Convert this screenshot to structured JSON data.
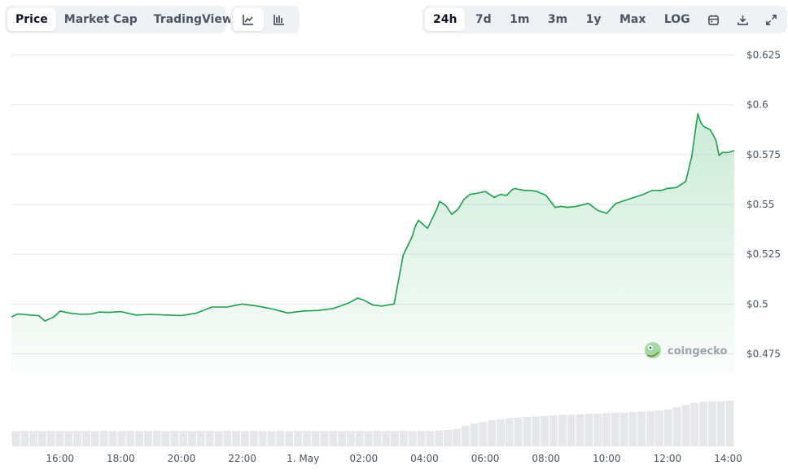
{
  "toolbar": {
    "chart_types": [
      {
        "label": "Price",
        "active": true
      },
      {
        "label": "Market Cap",
        "active": false
      },
      {
        "label": "TradingView",
        "active": false
      }
    ],
    "styles": [
      {
        "icon": "line-chart-icon",
        "active": true
      },
      {
        "icon": "candlestick-chart-icon",
        "active": false
      }
    ],
    "ranges": [
      {
        "label": "24h",
        "active": true
      },
      {
        "label": "7d",
        "active": false
      },
      {
        "label": "1m",
        "active": false
      },
      {
        "label": "3m",
        "active": false
      },
      {
        "label": "1y",
        "active": false
      },
      {
        "label": "Max",
        "active": false
      },
      {
        "label": "LOG",
        "active": false
      }
    ],
    "actions": [
      "calendar-icon",
      "download-icon",
      "expand-icon"
    ]
  },
  "watermark": {
    "text": "coingecko",
    "icon": "coingecko-logo-icon"
  },
  "colors": {
    "line": "#16a34a",
    "fill_top": "#16a34a",
    "grid": "#e5e7eb",
    "volume": "#e5e7eb"
  },
  "chart_data": {
    "type": "area",
    "x_unit": "hours",
    "x_ticks": [
      {
        "label": "16:00",
        "value": 16
      },
      {
        "label": "18:00",
        "value": 18
      },
      {
        "label": "20:00",
        "value": 20
      },
      {
        "label": "22:00",
        "value": 22
      },
      {
        "label": "1. May",
        "value": 24
      },
      {
        "label": "02:00",
        "value": 26
      },
      {
        "label": "04:00",
        "value": 28
      },
      {
        "label": "06:00",
        "value": 30
      },
      {
        "label": "08:00",
        "value": 32
      },
      {
        "label": "10:00",
        "value": 34
      },
      {
        "label": "12:00",
        "value": 36
      },
      {
        "label": "14:00",
        "value": 38
      }
    ],
    "y_ticks": [
      {
        "label": "$0.475",
        "value": 0.475
      },
      {
        "label": "$0.5",
        "value": 0.5
      },
      {
        "label": "$0.525",
        "value": 0.525
      },
      {
        "label": "$0.55",
        "value": 0.55
      },
      {
        "label": "$0.575",
        "value": 0.575
      },
      {
        "label": "$0.6",
        "value": 0.6
      },
      {
        "label": "$0.625",
        "value": 0.625
      }
    ],
    "xlim": [
      14.4,
      38.2
    ],
    "ylim": [
      0.4654,
      0.6362
    ],
    "grid": true,
    "price": {
      "x": [
        14.4,
        14.6,
        14.8,
        15.0,
        15.3,
        15.5,
        15.8,
        16.0,
        16.3,
        16.7,
        17.0,
        17.3,
        17.6,
        18.0,
        18.5,
        19.0,
        19.5,
        20.0,
        20.5,
        21.0,
        21.5,
        22.0,
        22.5,
        23.0,
        23.5,
        24.0,
        24.5,
        25.0,
        25.5,
        25.8,
        26.0,
        26.3,
        26.6,
        26.8,
        27.0,
        27.3,
        27.6,
        27.7,
        27.8,
        28.1,
        28.4,
        28.5,
        28.7,
        28.9,
        29.1,
        29.3,
        29.5,
        29.7,
        30.0,
        30.3,
        30.5,
        30.7,
        30.9,
        31.0,
        31.1,
        31.3,
        31.5,
        31.7,
        32.0,
        32.3,
        32.5,
        32.7,
        33.0,
        33.4,
        33.7,
        34.0,
        34.3,
        34.6,
        34.9,
        35.2,
        35.5,
        35.8,
        36.0,
        36.3,
        36.6,
        36.8,
        36.9,
        37.0,
        37.1,
        37.2,
        37.4,
        37.5,
        37.6,
        37.7,
        37.8,
        38.0,
        38.2
      ],
      "y": [
        0.4935,
        0.495,
        0.4948,
        0.4945,
        0.4942,
        0.4915,
        0.4935,
        0.4965,
        0.4955,
        0.4948,
        0.495,
        0.496,
        0.4958,
        0.4962,
        0.4945,
        0.4948,
        0.4945,
        0.4942,
        0.4955,
        0.4985,
        0.4985,
        0.5,
        0.499,
        0.4975,
        0.4955,
        0.4965,
        0.4968,
        0.4978,
        0.5005,
        0.503,
        0.502,
        0.4995,
        0.499,
        0.4995,
        0.5,
        0.5245,
        0.534,
        0.539,
        0.542,
        0.538,
        0.5475,
        0.5515,
        0.5495,
        0.545,
        0.5475,
        0.5525,
        0.555,
        0.5555,
        0.5565,
        0.5535,
        0.555,
        0.5545,
        0.5575,
        0.558,
        0.5575,
        0.557,
        0.557,
        0.5565,
        0.5545,
        0.5485,
        0.549,
        0.5485,
        0.549,
        0.5505,
        0.547,
        0.5455,
        0.5505,
        0.552,
        0.5535,
        0.555,
        0.557,
        0.557,
        0.558,
        0.5585,
        0.5615,
        0.574,
        0.585,
        0.5955,
        0.591,
        0.589,
        0.5875,
        0.585,
        0.582,
        0.5745,
        0.576,
        0.576,
        0.577
      ]
    },
    "volume": {
      "x_start": 14.4,
      "x_end": 38.2,
      "note_values_relative": [
        0.28,
        0.28,
        0.28,
        0.28,
        0.28,
        0.28,
        0.28,
        0.28,
        0.28,
        0.28,
        0.28,
        0.28,
        0.28,
        0.28,
        0.28,
        0.28,
        0.28,
        0.28,
        0.28,
        0.28,
        0.28,
        0.28,
        0.28,
        0.28,
        0.28,
        0.28,
        0.28,
        0.28,
        0.28,
        0.28,
        0.28,
        0.28,
        0.28,
        0.28,
        0.28,
        0.28,
        0.28,
        0.28,
        0.28,
        0.28,
        0.28,
        0.28,
        0.28,
        0.28,
        0.28,
        0.28,
        0.28,
        0.28,
        0.29,
        0.3,
        0.32,
        0.38,
        0.42,
        0.45,
        0.48,
        0.5,
        0.52,
        0.53,
        0.54,
        0.55,
        0.56,
        0.57,
        0.58,
        0.58,
        0.59,
        0.6,
        0.6,
        0.61,
        0.62,
        0.62,
        0.63,
        0.64,
        0.65,
        0.66,
        0.68,
        0.72,
        0.76,
        0.8,
        0.82,
        0.83,
        0.83,
        0.84
      ]
    }
  }
}
